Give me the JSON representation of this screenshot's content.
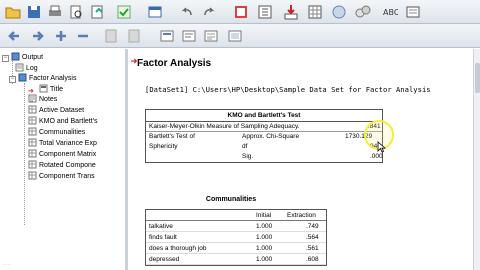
{
  "outline": {
    "items": [
      {
        "label": "Output"
      },
      {
        "label": "Log"
      },
      {
        "label": "Factor Analysis"
      },
      {
        "label": "Title"
      },
      {
        "label": "Notes"
      },
      {
        "label": "Active Dataset"
      },
      {
        "label": "KMO and Bartlett's"
      },
      {
        "label": "Communalities"
      },
      {
        "label": "Total Variance Exp"
      },
      {
        "label": "Component Matrix"
      },
      {
        "label": "Rotated Compone"
      },
      {
        "label": "Component Trans"
      }
    ]
  },
  "output": {
    "title": "Factor Analysis",
    "dataset_line": "[DataSet1] C:\\Users\\HP\\Desktop\\Sample Data Set for Factor Analysis"
  },
  "kmo": {
    "title": "KMO and Bartlett's Test",
    "row1_label": "Kaiser-Meyer-Olkin Measure of Sampling Adequacy.",
    "row1_value": ".841",
    "row2_label_a": "Bartlett's Test of",
    "row2_label_b": "Sphericity",
    "row2_sub": "Approx. Chi-Square",
    "row2_value": "1730.129",
    "row3_sub": "df",
    "row3_value": "946",
    "row4_sub": "Sig.",
    "row4_value": ".000"
  },
  "communalities": {
    "title": "Communalities",
    "headers": [
      "Initial",
      "Extraction"
    ],
    "rows": [
      {
        "name": "talkative",
        "initial": "1.000",
        "extraction": ".749"
      },
      {
        "name": "finds fault",
        "initial": "1.000",
        "extraction": ".564"
      },
      {
        "name": "does a thorough job",
        "initial": "1.000",
        "extraction": ".561"
      },
      {
        "name": "depressed",
        "initial": "1.000",
        "extraction": ".608"
      }
    ]
  },
  "watermark": "·····"
}
